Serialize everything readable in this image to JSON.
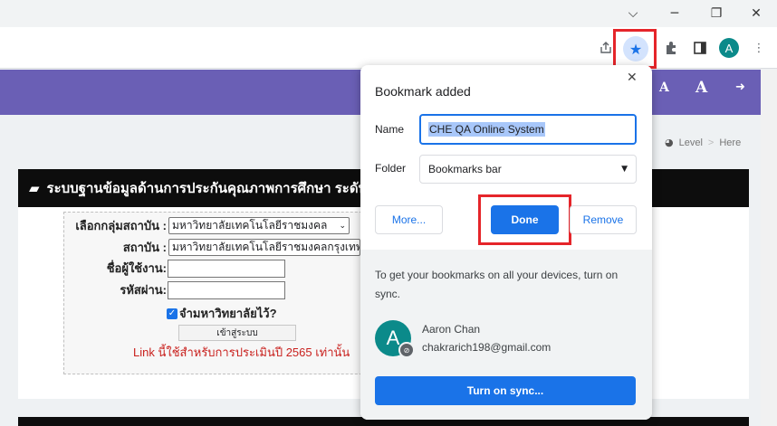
{
  "titlebar": {
    "icons": [
      "chevron-down-icon",
      "minimize-icon",
      "restore-icon",
      "close-icon"
    ]
  },
  "toolbar": {
    "profile_initial": "A",
    "icons": [
      "share-icon",
      "star-icon",
      "puzzle-icon",
      "sidepanel-icon",
      "kebab-menu-icon"
    ]
  },
  "page": {
    "header_icons": [
      "A",
      "A"
    ],
    "breadcrumb": {
      "level": "Level",
      "sep": ">",
      "here": "Here"
    },
    "card_title": "ระบบฐานข้อมูลด้านการประกันคุณภาพการศึกษา ระดับ",
    "form": {
      "group_label": "เลือกกลุ่มสถาบัน :",
      "group_value": "มหาวิทยาลัยเทคโนโลยีราชมงคล",
      "institution_label": "สถาบัน :",
      "institution_value": "มหาวิทยาลัยเทคโนโลยีราชมงคลกรุงเทพ",
      "username_label": "ชื่อผู้ใช้งาน:",
      "password_label": "รหัสผ่าน:",
      "remember_label": "จำมหาวิทยาลัยไว้?",
      "submit_label": "เข้าสู่ระบบ",
      "note": "Link นี้ใช้สำหรับการประเมินปี 2565 เท่านั้น"
    }
  },
  "bookmark_popup": {
    "title": "Bookmark added",
    "name_label": "Name",
    "name_value": "CHE QA Online System",
    "folder_label": "Folder",
    "folder_value": "Bookmarks bar",
    "more_label": "More...",
    "done_label": "Done",
    "remove_label": "Remove",
    "sync_text": "To get your bookmarks on all your devices, turn on sync.",
    "account_initial": "A",
    "account_name": "Aaron Chan",
    "account_email": "chakrarich198@gmail.com",
    "sync_button": "Turn on sync..."
  },
  "colors": {
    "accent": "#1a73e8",
    "header": "#6a5fb5",
    "highlight_box": "#e5252a"
  }
}
